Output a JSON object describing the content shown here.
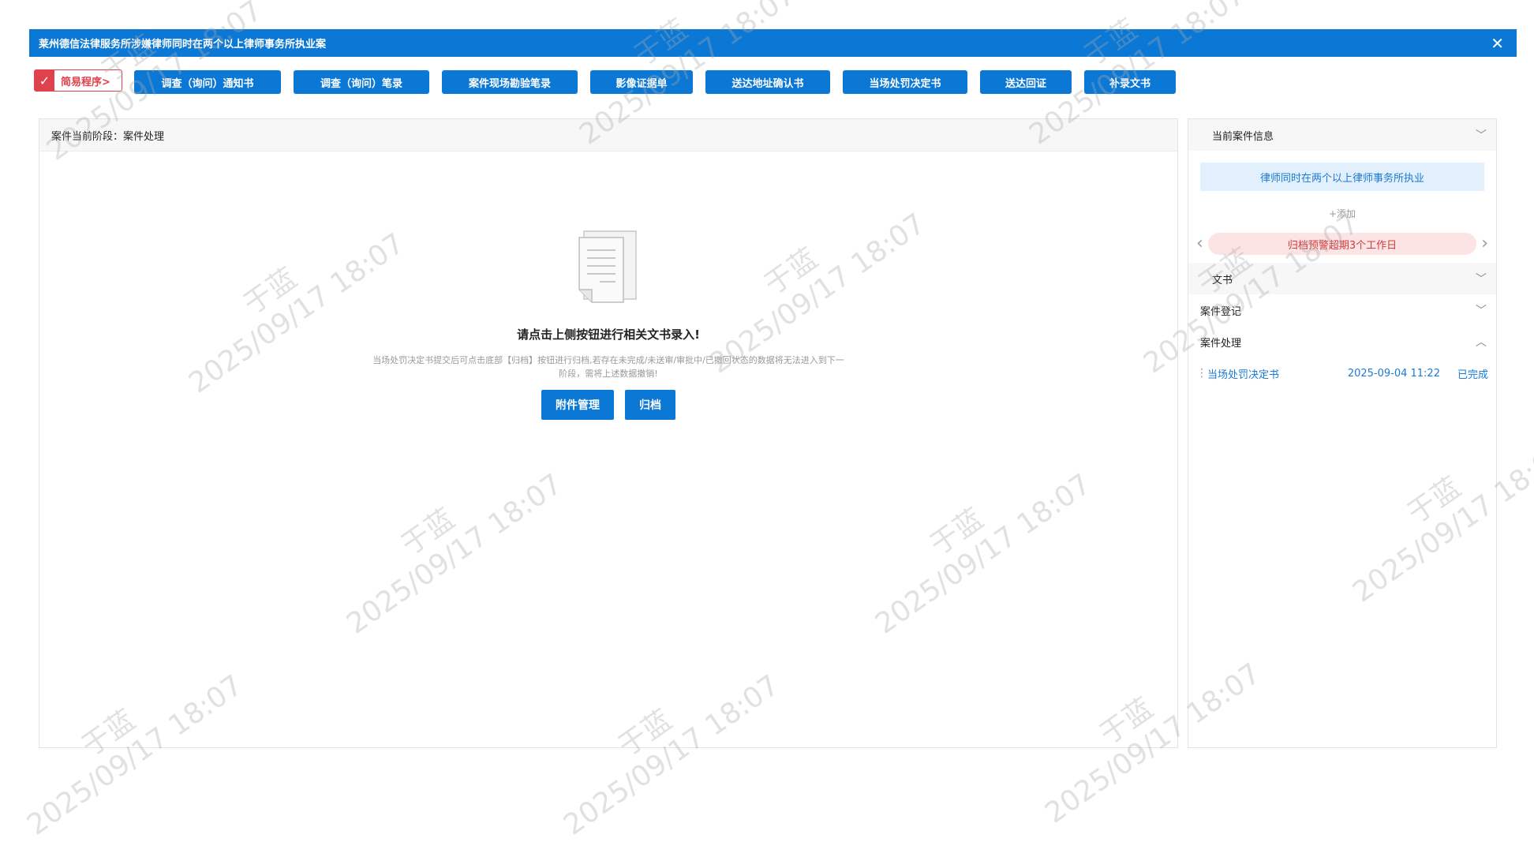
{
  "window": {
    "title": "莱州德信法律服务所涉嫌律师同时在两个以上律师事务所执业案",
    "close_icon": "close-icon"
  },
  "toolbar": {
    "simple_procedure": "简易程序>",
    "buttons": [
      "调查（询问）通知书",
      "调查（询问）笔录",
      "案件现场勘验笔录",
      "影像证据单",
      "送达地址确认书",
      "当场处罚决定书",
      "送达回证",
      "补录文书"
    ]
  },
  "left_panel": {
    "stage_label": "案件当前阶段：案件处理",
    "empty_icon": "document-icon",
    "empty_title": "请点击上侧按钮进行相关文书录入!",
    "empty_hint": "当场处罚决定书提交后可点击底部【归档】按钮进行归档,若存在未完成/未送审/审批中/已撤回状态的数据将无法进入到下一阶段，需将上述数据撤销!",
    "attachments_button": "附件管理",
    "archive_button": "归档"
  },
  "right_panel": {
    "header": "当前案件信息",
    "case_name": "律师同时在两个以上律师事务所执业",
    "add_link": "+添加",
    "warning": "归档预警超期3个工作日",
    "sections": {
      "documents": "文书",
      "registration": "案件登记",
      "processing": "案件处理"
    },
    "processing_items": [
      {
        "name": "当场处罚决定书",
        "time": "2025-09-04 11:22",
        "status": "已完成"
      }
    ]
  },
  "watermark": {
    "name": "于蓝",
    "time": "2025/09/17 18:07"
  }
}
